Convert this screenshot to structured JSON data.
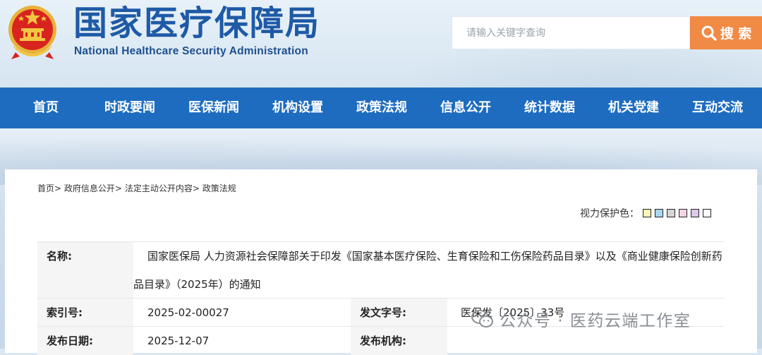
{
  "header": {
    "title": "国家医疗保障局",
    "subtitle": "National Healthcare Security Administration"
  },
  "search": {
    "placeholder": "请输入关键字查询",
    "button_label": "搜 索"
  },
  "nav": {
    "items": [
      {
        "label": "首页"
      },
      {
        "label": "时政要闻"
      },
      {
        "label": "医保新闻"
      },
      {
        "label": "机构设置"
      },
      {
        "label": "政策法规"
      },
      {
        "label": "信息公开"
      },
      {
        "label": "统计数据"
      },
      {
        "label": "机关党建"
      },
      {
        "label": "互动交流"
      }
    ]
  },
  "breadcrumb": {
    "items": [
      "首页",
      "政府信息公开",
      "法定主动公开内容",
      "政策法规"
    ],
    "separator": ">"
  },
  "eye_care": {
    "label": "视力保护色：",
    "swatches": [
      "#fdf5b8",
      "#a9d6ef",
      "#d6d6d6",
      "#f6d3e6",
      "#dcc8ec",
      "#ffffff"
    ]
  },
  "info": {
    "name_label": "名称:",
    "name_value": "国家医保局 人力资源社会保障部关于印发《国家基本医疗保险、生育保险和工伤保险药品目录》以及《商业健康保险创新药品目录》（2025年）的通知",
    "index_label": "索引号:",
    "index_value": "2025-02-00027",
    "doc_no_label": "发文字号:",
    "doc_no_value": "医保发〔2025〕33号",
    "date_label": "发布日期:",
    "date_value": "2025-12-07",
    "org_label": "发布机构:",
    "org_value": ""
  },
  "watermark": {
    "text": "公众号 · 医药云端工作室",
    "icon": "wechat-icon"
  }
}
